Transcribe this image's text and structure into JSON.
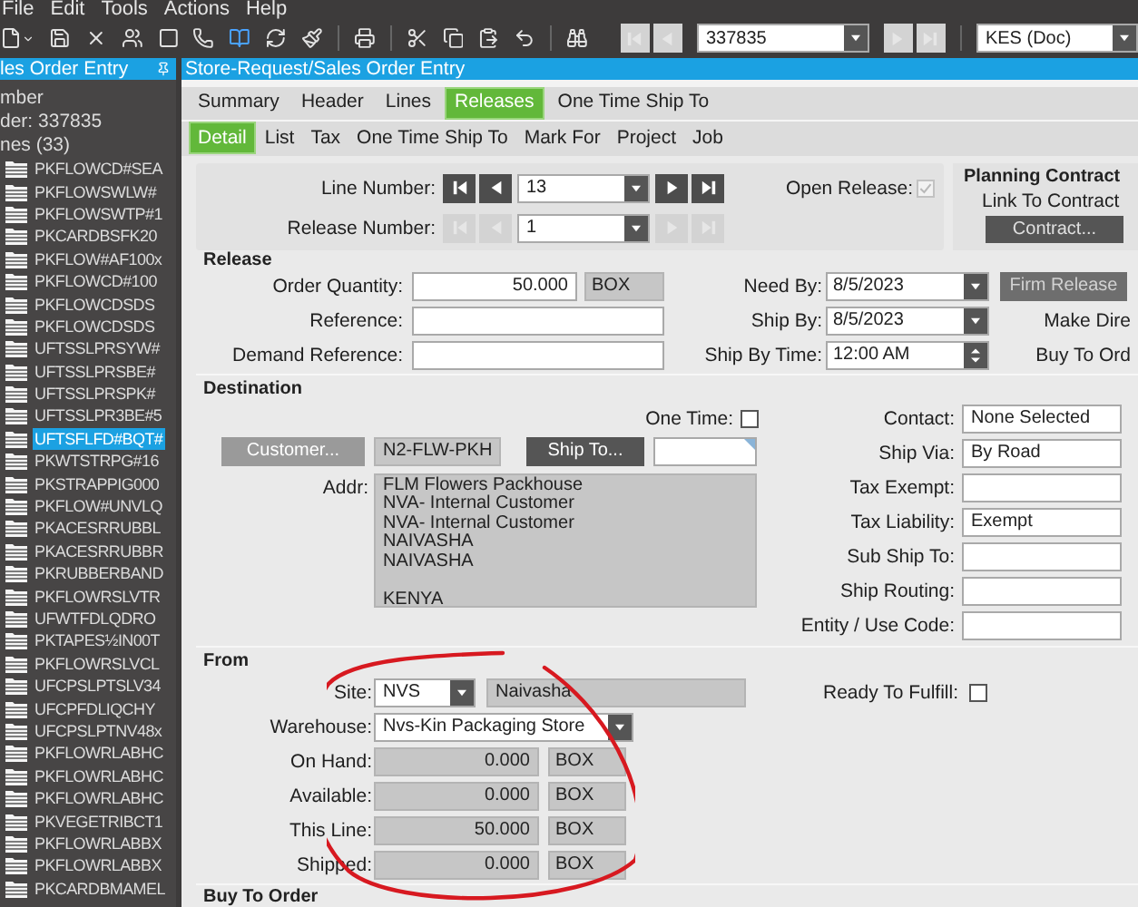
{
  "menu": [
    "File",
    "Edit",
    "Tools",
    "Actions",
    "Help"
  ],
  "toolbar": {
    "record": "337835",
    "company": "KES (Doc)",
    "nav_disabled": true
  },
  "sidebar": {
    "title": "les Order Entry",
    "lines": [
      "mber",
      "der: 337835",
      "nes (33)"
    ],
    "items": [
      {
        "label": "PKFLOWCD#SEA",
        "selected": false
      },
      {
        "label": "PKFLOWSWLW#",
        "selected": false
      },
      {
        "label": "PKFLOWSWTP#1",
        "selected": false
      },
      {
        "label": "PKCARDBSFK20",
        "selected": false
      },
      {
        "label": "PKFLOW#AF100x",
        "selected": false
      },
      {
        "label": "PKFLOWCD#100",
        "selected": false
      },
      {
        "label": "PKFLOWCDSDS",
        "selected": false
      },
      {
        "label": "PKFLOWCDSDS",
        "selected": false
      },
      {
        "label": "UFTSSLPRSYW#",
        "selected": false
      },
      {
        "label": "UFTSSLPRSBE#",
        "selected": false
      },
      {
        "label": "UFTSSLPRSPK#",
        "selected": false
      },
      {
        "label": "UFTSSLPR3BE#5",
        "selected": false
      },
      {
        "label": "UFTSFLFD#BQT#",
        "selected": true
      },
      {
        "label": "PKWTSTRPG#16",
        "selected": false
      },
      {
        "label": "PKSTRAPPIG000",
        "selected": false
      },
      {
        "label": "PKFLOW#UNVLQ",
        "selected": false
      },
      {
        "label": "PKACESRRUBBL",
        "selected": false
      },
      {
        "label": "PKACESRRUBBR",
        "selected": false
      },
      {
        "label": "PKRUBBERBAND",
        "selected": false
      },
      {
        "label": "PKFLOWRSLVTR",
        "selected": false
      },
      {
        "label": "UFWTFDLQDRO",
        "selected": false
      },
      {
        "label": "PKTAPES½IN00T",
        "selected": false
      },
      {
        "label": "PKFLOWRSLVCL",
        "selected": false
      },
      {
        "label": "UFCPSLPTSLV34",
        "selected": false
      },
      {
        "label": "UFCPFDLIQCHY",
        "selected": false
      },
      {
        "label": "UFCPSLPTNV48x",
        "selected": false
      },
      {
        "label": "PKFLOWRLABHC",
        "selected": false
      },
      {
        "label": "PKFLOWRLABHC",
        "selected": false
      },
      {
        "label": "PKFLOWRLABHC",
        "selected": false
      },
      {
        "label": "PKVEGETRIBCT1",
        "selected": false
      },
      {
        "label": "PKFLOWRLABBX",
        "selected": false
      },
      {
        "label": "PKFLOWRLABBX",
        "selected": false
      },
      {
        "label": "PKCARDBMAMEL",
        "selected": false
      }
    ]
  },
  "window": {
    "title": "Store-Request/Sales Order Entry"
  },
  "tabs": [
    {
      "label": "Summary",
      "selected": false
    },
    {
      "label": "Header",
      "selected": false
    },
    {
      "label": "Lines",
      "selected": false
    },
    {
      "label": "Releases",
      "selected": true
    },
    {
      "label": "One Time Ship To",
      "selected": false
    }
  ],
  "subtabs": [
    {
      "label": "Detail",
      "selected": true
    },
    {
      "label": "List",
      "selected": false
    },
    {
      "label": "Tax",
      "selected": false
    },
    {
      "label": "One Time Ship To",
      "selected": false
    },
    {
      "label": "Mark For",
      "selected": false
    },
    {
      "label": "Project",
      "selected": false
    },
    {
      "label": "Job",
      "selected": false
    }
  ],
  "line": {
    "line_number_label": "Line Number:",
    "line_number": "13",
    "release_number_label": "Release Number:",
    "release_number": "1",
    "release_nav_disabled": true,
    "open_release_label": "Open Release:",
    "open_release": true
  },
  "planning_contract": {
    "title": "Planning Contract",
    "link_label": "Link To Contract",
    "button": "Contract..."
  },
  "release": {
    "title": "Release",
    "left": [
      {
        "label": "Order Quantity:",
        "value": "50.000",
        "unit": "BOX"
      },
      {
        "label": "Reference:"
      },
      {
        "label": "Demand Reference:"
      }
    ],
    "dates": [
      {
        "label": "Need By:",
        "value": "8/5/2023",
        "kind": "date"
      },
      {
        "label": "Ship By:",
        "value": "8/5/2023",
        "kind": "date"
      },
      {
        "label": "Ship By Time:",
        "value": "12:00 AM",
        "kind": "time"
      }
    ],
    "actions": [
      {
        "kind": "button",
        "label": "Firm Release"
      },
      {
        "kind": "text",
        "label": "Make Dire"
      },
      {
        "kind": "text",
        "label": "Buy To Ord"
      }
    ]
  },
  "destination": {
    "title": "Destination",
    "one_time_label": "One Time:",
    "one_time": false,
    "customer_button": "Customer...",
    "customer_id": "N2-FLW-PKH",
    "ship_to_button": "Ship To...",
    "addr_label": "Addr:",
    "address": [
      "FLM Flowers Packhouse",
      "NVA- Internal Customer",
      "NVA- Internal Customer",
      "NAIVASHA",
      "NAIVASHA"
    ],
    "country": "KENYA",
    "fields": [
      {
        "label": "Contact:",
        "value": "None Selected"
      },
      {
        "label": "Ship Via:",
        "value": "By Road"
      },
      {
        "label": "Tax Exempt:"
      },
      {
        "label": "Tax Liability:",
        "value": "Exempt"
      },
      {
        "label": "Sub Ship To:"
      },
      {
        "label": "Ship Routing:"
      },
      {
        "label": "Entity / Use Code:"
      }
    ]
  },
  "from": {
    "title": "From",
    "site_label": "Site:",
    "site": "NVS",
    "site_name": "Naivasha",
    "warehouse_label": "Warehouse:",
    "warehouse": "Nvs-Kin Packaging Store",
    "quantities": [
      {
        "label": "On Hand:",
        "value": "0.000",
        "unit": "BOX"
      },
      {
        "label": "Available:",
        "value": "0.000",
        "unit": "BOX"
      },
      {
        "label": "This Line:",
        "value": "50.000",
        "unit": "BOX"
      },
      {
        "label": "Shipped:",
        "value": "0.000",
        "unit": "BOX"
      }
    ],
    "ready_label": "Ready To Fulfill:",
    "ready": false
  },
  "buy_to_order": {
    "title": "Buy To Order"
  }
}
